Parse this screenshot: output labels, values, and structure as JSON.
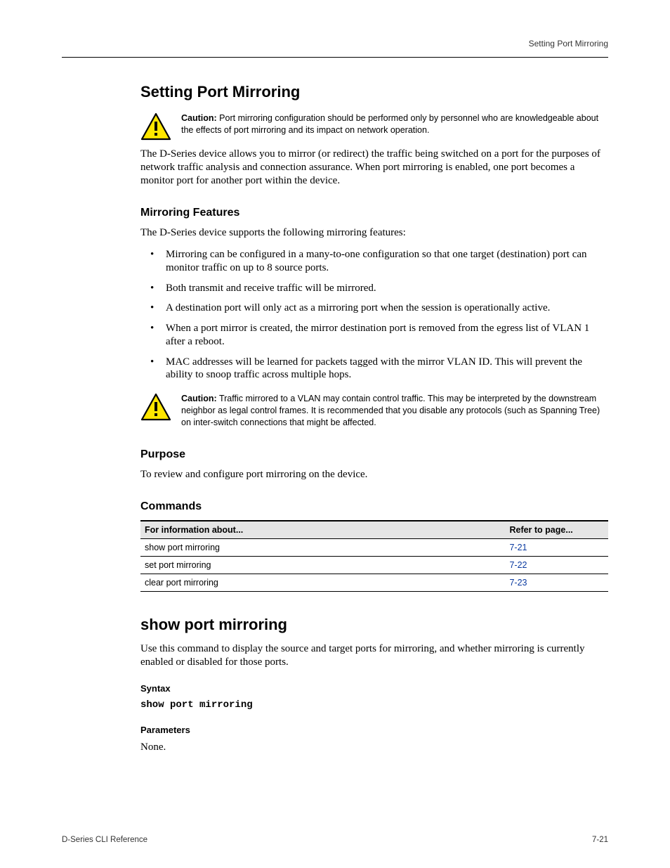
{
  "running_head": "Setting Port Mirroring",
  "h1_mirroring": "Setting Port Mirroring",
  "caution1_label": "Caution:",
  "caution1_text": "Port mirroring configuration should be performed only by personnel who are knowledgeable about the effects of port mirroring and its impact on network operation.",
  "para_intro": "The D-Series device allows you to mirror (or redirect) the traffic being switched on a port for the purposes of network traffic analysis and connection assurance. When port mirroring is enabled, one port becomes a monitor port for another port within the device.",
  "h2_features": "Mirroring Features",
  "para_features_intro": "The D-Series device supports the following mirroring features:",
  "bullets": [
    "Mirroring can be configured in a many-to-one configuration so that one target (destination) port can monitor traffic on up to 8 source ports.",
    "Both transmit and receive traffic will be mirrored.",
    "A destination port will only act as a mirroring port when the session is operationally active.",
    "When a port mirror is created, the mirror destination port is removed from the egress list of VLAN 1 after a reboot.",
    "MAC addresses will be learned for packets tagged with the mirror VLAN ID. This will prevent the ability to snoop traffic across multiple hops."
  ],
  "caution2_label": "Caution:",
  "caution2_text": "Traffic mirrored to a VLAN may contain control traffic. This may be interpreted by the downstream neighbor as legal control frames. It is recommended that you disable any protocols (such as Spanning Tree) on inter-switch connections that might be affected.",
  "h2_purpose": "Purpose",
  "para_purpose": "To review and configure port mirroring on the device.",
  "h2_commands": "Commands",
  "table_header_task": "For information about...",
  "table_header_page": "Refer to page...",
  "table_rows": [
    {
      "task": "show port mirroring",
      "page": "7-21"
    },
    {
      "task": "set port mirroring",
      "page": "7-22"
    },
    {
      "task": "clear port mirroring",
      "page": "7-23"
    }
  ],
  "h1_showcmd": "show port mirroring",
  "para_showcmd": "Use this command to display the source and target ports for mirroring, and whether mirroring is currently enabled or disabled for those ports.",
  "h3_syntax": "Syntax",
  "syntax_text": "show port mirroring",
  "h3_parameters": "Parameters",
  "para_parameters": "None.",
  "footer_left": "D-Series CLI Reference",
  "footer_right": "7-21"
}
